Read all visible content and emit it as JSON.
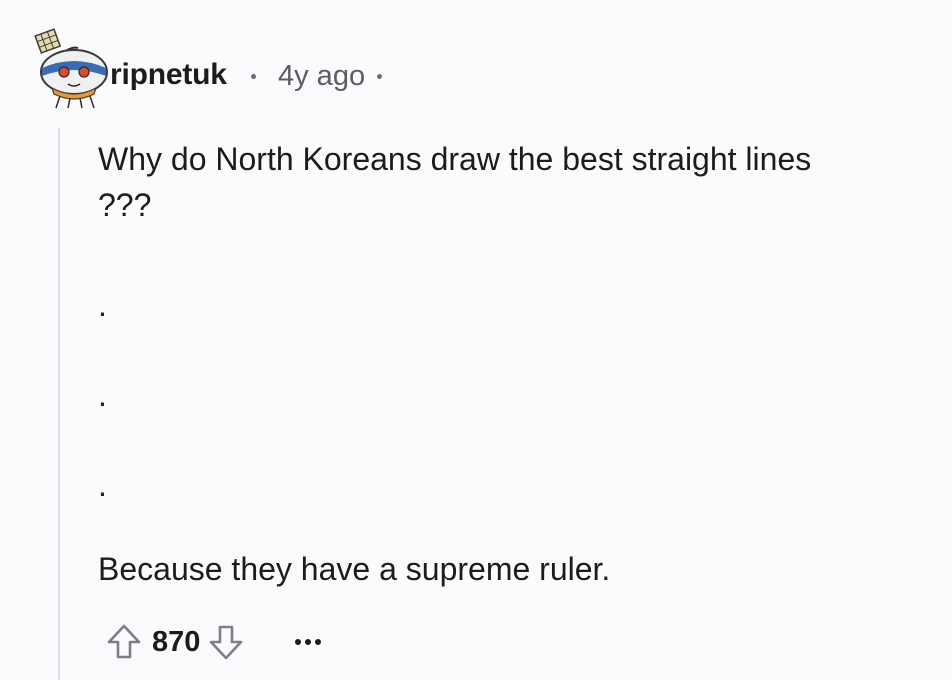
{
  "comment": {
    "author": "ripnetuk",
    "age": "4y ago",
    "lines": [
      "Why do North Koreans draw the best straight lines",
      "???",
      ".",
      ".",
      ".",
      "Because they have a supreme ruler."
    ],
    "score": "870"
  },
  "icons": {
    "avatar": "snoo-avatar-icon",
    "upvote": "upvote-arrow-icon",
    "downvote": "downvote-arrow-icon",
    "more": "more-options-icon"
  },
  "colors": {
    "background": "#fbfbfd",
    "text": "#1c1c1c",
    "meta": "#5a5e62",
    "thread_line": "#dcdfe3",
    "icon_stroke": "#7c8085"
  }
}
